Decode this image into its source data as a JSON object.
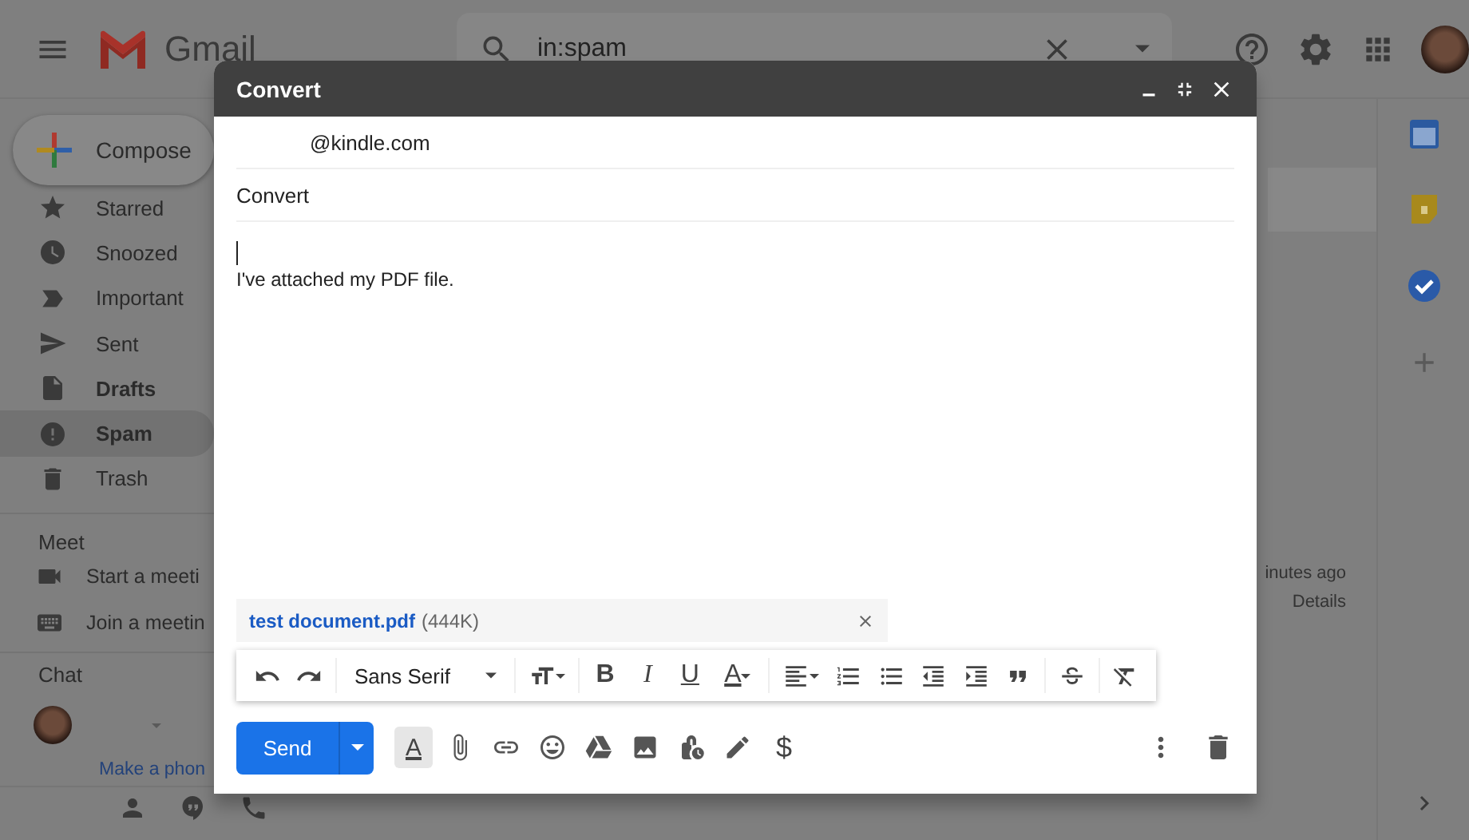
{
  "top_bar": {
    "app_name": "Gmail",
    "search": {
      "value": "in:spam"
    }
  },
  "sidebar": {
    "compose": "Compose",
    "items": [
      {
        "label": "Starred",
        "bold": false,
        "selected": false
      },
      {
        "label": "Snoozed",
        "bold": false,
        "selected": false
      },
      {
        "label": "Important",
        "bold": false,
        "selected": false
      },
      {
        "label": "Sent",
        "bold": false,
        "selected": false
      },
      {
        "label": "Drafts",
        "bold": true,
        "selected": false
      },
      {
        "label": "Spam",
        "bold": true,
        "selected": true
      },
      {
        "label": "Trash",
        "bold": false,
        "selected": false
      }
    ],
    "meet": {
      "title": "Meet",
      "items": [
        {
          "label": "Start a meeti"
        },
        {
          "label": "Join a meetin"
        }
      ]
    },
    "chat": {
      "title": "Chat",
      "phone_link": "Make a phon"
    }
  },
  "mail_list": {
    "time": "inutes ago",
    "details": "Details"
  },
  "compose": {
    "title": "Convert",
    "to": "@kindle.com",
    "subject": "Convert",
    "body": "I've attached my PDF file.",
    "attachment": {
      "name": "test document.pdf",
      "size": "(444K)"
    },
    "toolbar": [
      {
        "kind": "undo"
      },
      {
        "kind": "redo"
      },
      {
        "kind": "font",
        "label": "Sans Serif"
      },
      {
        "kind": "size"
      },
      {
        "kind": "bold",
        "glyph": "B"
      },
      {
        "kind": "italic",
        "glyph": "I"
      },
      {
        "kind": "underline",
        "glyph": "U"
      },
      {
        "kind": "color",
        "glyph": "A"
      },
      {
        "kind": "align"
      },
      {
        "kind": "numbered"
      },
      {
        "kind": "bulleted"
      },
      {
        "kind": "outdent"
      },
      {
        "kind": "indent"
      },
      {
        "kind": "quote"
      },
      {
        "kind": "strike"
      },
      {
        "kind": "clear"
      }
    ],
    "send": "Send",
    "bottom_tools": [
      {
        "kind": "format",
        "glyph": "A",
        "selected": true
      },
      {
        "kind": "attach"
      },
      {
        "kind": "link"
      },
      {
        "kind": "emoji"
      },
      {
        "kind": "drive"
      },
      {
        "kind": "photo"
      },
      {
        "kind": "confidential"
      },
      {
        "kind": "signature"
      },
      {
        "kind": "money",
        "glyph": "$"
      }
    ]
  }
}
